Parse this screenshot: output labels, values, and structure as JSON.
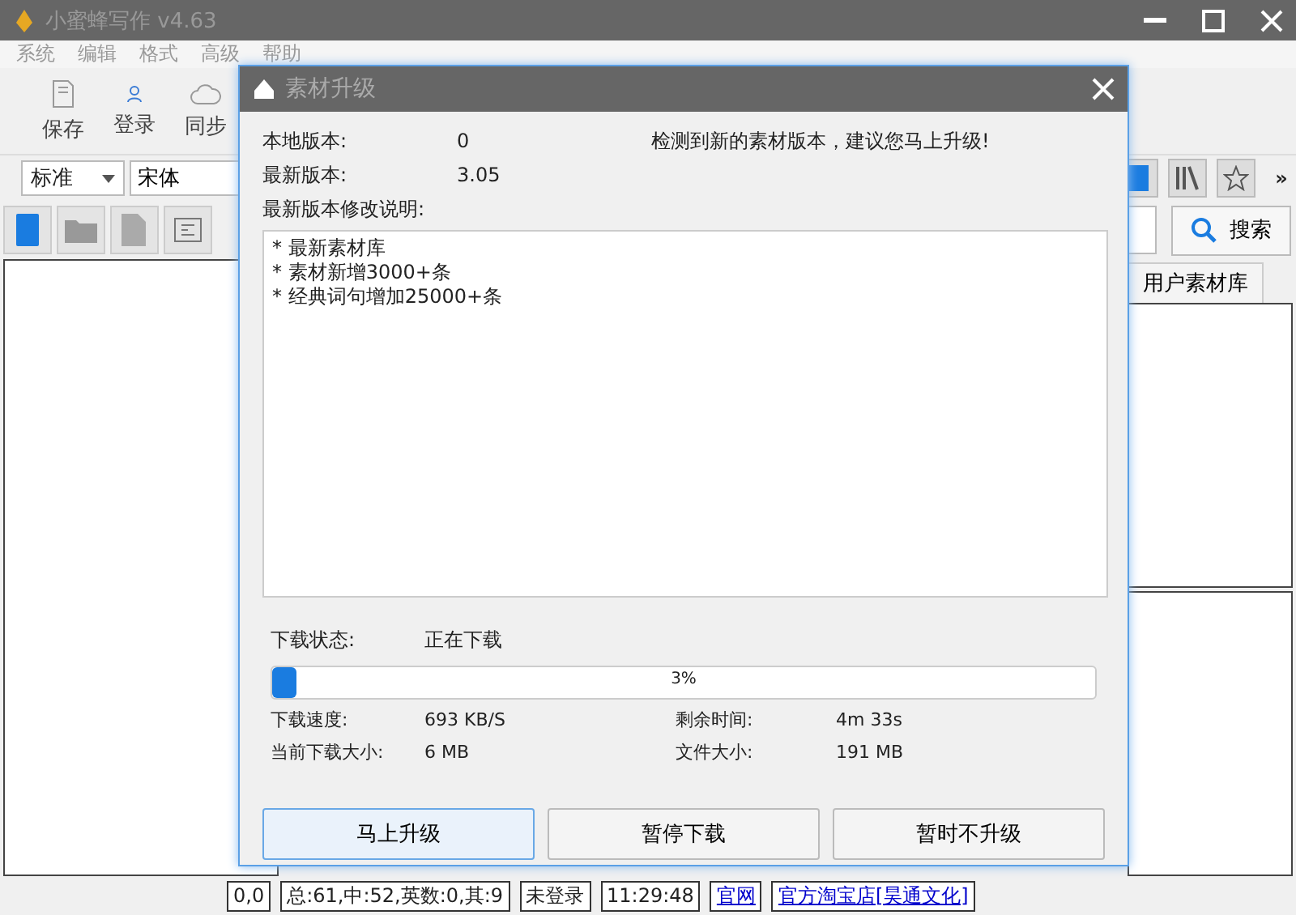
{
  "window": {
    "title": "小蜜蜂写作 v4.63"
  },
  "menu": [
    "系统",
    "编辑",
    "格式",
    "高级",
    "帮助"
  ],
  "toolbar": [
    {
      "label": "保存",
      "kind": "save"
    },
    {
      "label": "登录",
      "kind": "user"
    },
    {
      "label": "同步",
      "kind": "cloud"
    }
  ],
  "format_bar": {
    "style": "标准",
    "font": "宋体",
    "more": "»"
  },
  "search": {
    "button": "搜索"
  },
  "tabs": [
    {
      "label": "用户素材库",
      "selected": true
    }
  ],
  "dialog": {
    "title": "素材升级",
    "local_version_label": "本地版本:",
    "local_version": "0",
    "latest_version_label": "最新版本:",
    "latest_version": "3.05",
    "notice": "检测到新的素材版本，建议您马上升级!",
    "notes_label": "最新版本修改说明:",
    "notes": [
      "* 最新素材库",
      "* 素材新增3000+条",
      "* 经典词句增加25000+条"
    ],
    "download_status_label": "下载状态:",
    "download_status": "正在下载",
    "progress": {
      "level": 0.03,
      "reading": "3%"
    },
    "stats": [
      {
        "label": "下载速度:",
        "value": "693 KB/S"
      },
      {
        "label": "剩余时间:",
        "value": "4m 33s"
      },
      {
        "label": "当前下载大小:",
        "value": "6 MB"
      },
      {
        "label": "文件大小:",
        "value": "191 MB"
      }
    ],
    "buttons": [
      {
        "label": "马上升级",
        "focused": true
      },
      {
        "label": "暂停下载",
        "focused": false
      },
      {
        "label": "暂时不升级",
        "focused": false
      }
    ]
  },
  "status_bar": [
    {
      "text": "0,0",
      "kind": "cell"
    },
    {
      "text": "总:61,中:52,英数:0,其:9",
      "kind": "cell"
    },
    {
      "text": "未登录",
      "kind": "cell"
    },
    {
      "text": "11:29:48",
      "kind": "cell"
    },
    {
      "text": "官网",
      "kind": "link"
    },
    {
      "text": "官方淘宝店[昊通文化]",
      "kind": "link"
    }
  ]
}
